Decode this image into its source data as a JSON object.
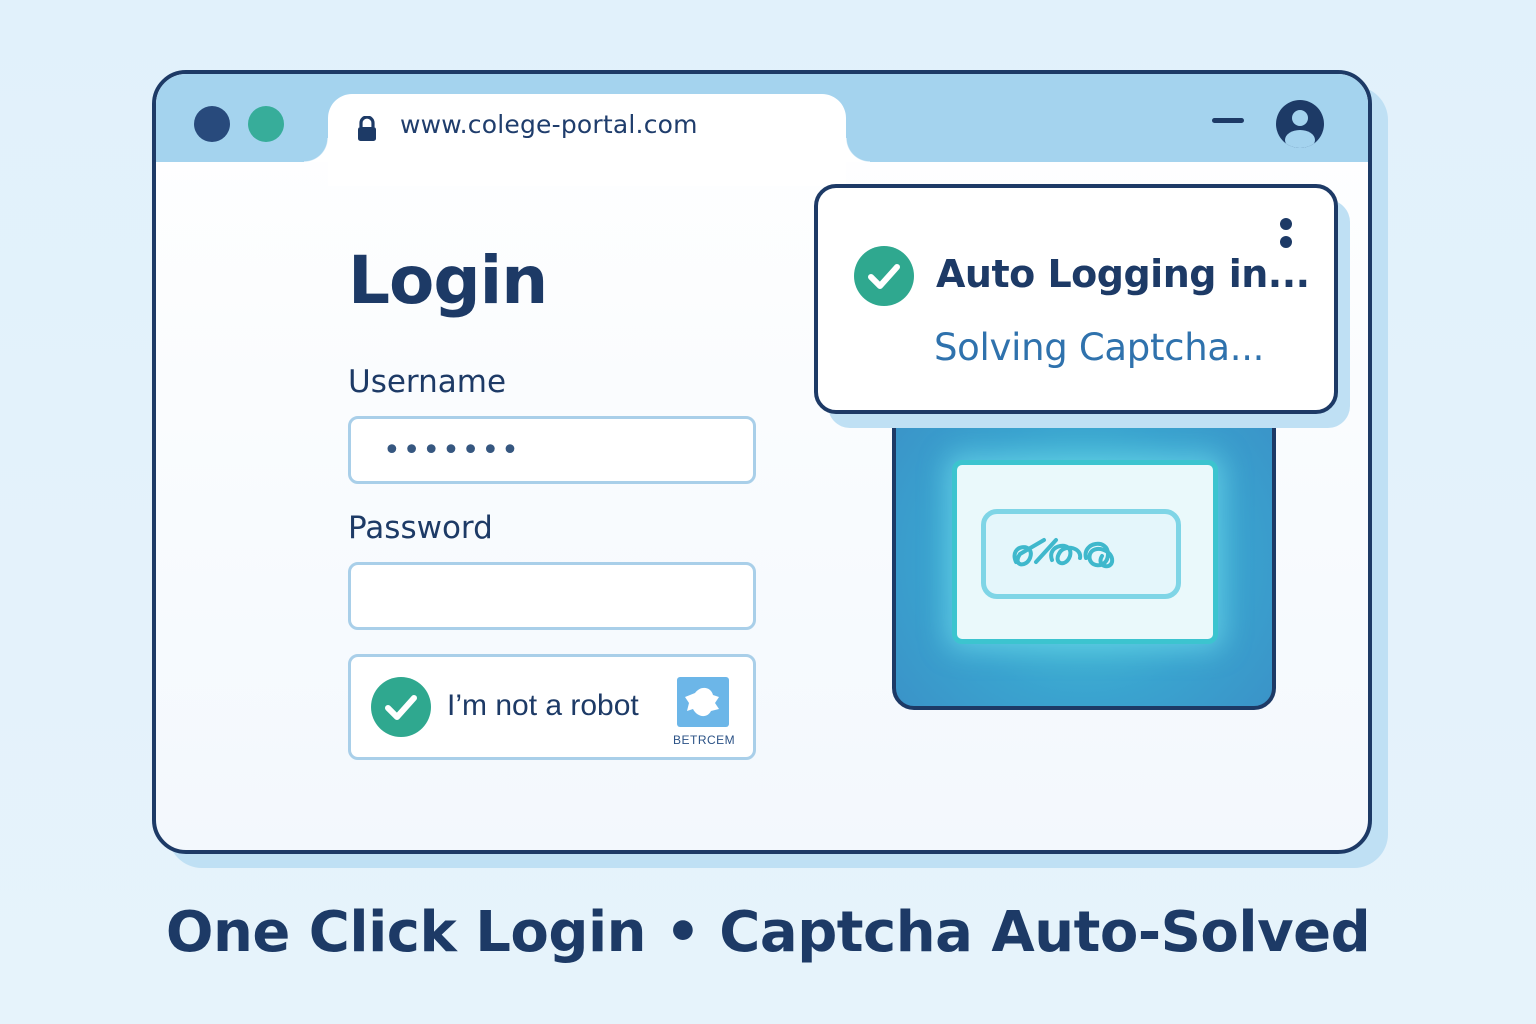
{
  "browser": {
    "url": "www.colege-portal.com",
    "icons": [
      "lock-icon",
      "minimize-icon",
      "profile-icon"
    ]
  },
  "login": {
    "title": "Login",
    "username_label": "Username",
    "username_value": "•••••••",
    "password_label": "Password",
    "password_value": "",
    "captcha_label": "I’m not a robot",
    "captcha_brand": "BETRCEM",
    "captcha_checked": true
  },
  "popup": {
    "title": "Auto Logging in...",
    "subtitle": "Solving Captcha..."
  },
  "footer": {
    "tagline": "One Click Login • Captcha Auto-Solved"
  },
  "colors": {
    "navy": "#1d3a66",
    "teal": "#2fa88f",
    "sky": "#a4d3ee",
    "accent_blue": "#2f72ad"
  }
}
